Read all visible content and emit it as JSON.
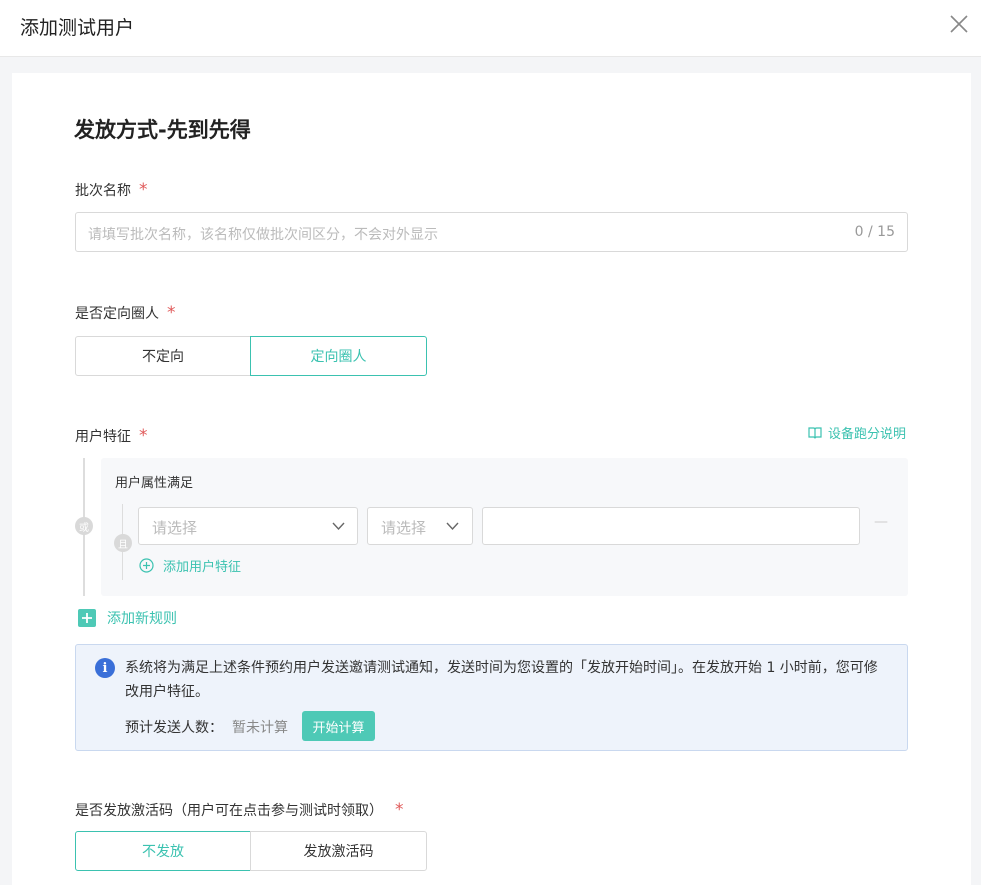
{
  "modal": {
    "title": "添加测试用户"
  },
  "section": {
    "title": "发放方式-先到先得"
  },
  "required_mark": "*",
  "batch_name": {
    "label": "批次名称",
    "placeholder": "请填写批次名称，该名称仅做批次间区分，不会对外显示",
    "counter": "0 / 15"
  },
  "targeting": {
    "label": "是否定向圈人",
    "options": [
      "不定向",
      "定向圈人"
    ],
    "selected": "定向圈人"
  },
  "user_features": {
    "label": "用户特征",
    "help_link": "设备跑分说明",
    "or_badge": "或",
    "and_badge": "且",
    "group_title": "用户属性满足",
    "select1_placeholder": "请选择",
    "select2_placeholder": "请选择",
    "value_input": "",
    "remove_symbol": "—",
    "add_feature": "添加用户特征",
    "add_rule": "添加新规则"
  },
  "notice": {
    "text": "系统将为满足上述条件预约用户发送邀请测试通知，发送时间为您设置的「发放开始时间」。在发放开始 1 小时前，您可修改用户特征。",
    "estimate_label": "预计发送人数：",
    "estimate_value": "暂未计算",
    "calc_button": "开始计算"
  },
  "activation": {
    "label": "是否发放激活码（用户可在点击参与测试时领取）",
    "options": [
      "不发放",
      "发放激活码"
    ],
    "selected": "不发放"
  },
  "colors": {
    "accent": "#3bc2b0",
    "required": "#e05a5a",
    "info": "#3a6fd8"
  }
}
